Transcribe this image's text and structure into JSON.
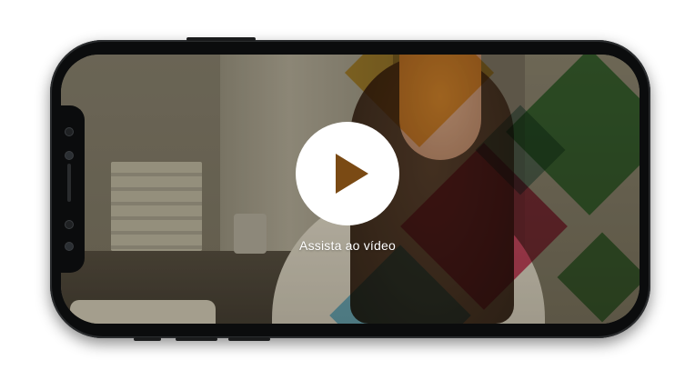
{
  "video": {
    "play_label": "Assista ao vídeo"
  },
  "icons": {
    "play": "play-icon"
  },
  "colors": {
    "accent_yellow": "#f0b419",
    "accent_green": "#33a03a",
    "accent_red": "#d21f4f",
    "accent_blue": "#55b8e8",
    "play_icon": "#7a4a14"
  }
}
